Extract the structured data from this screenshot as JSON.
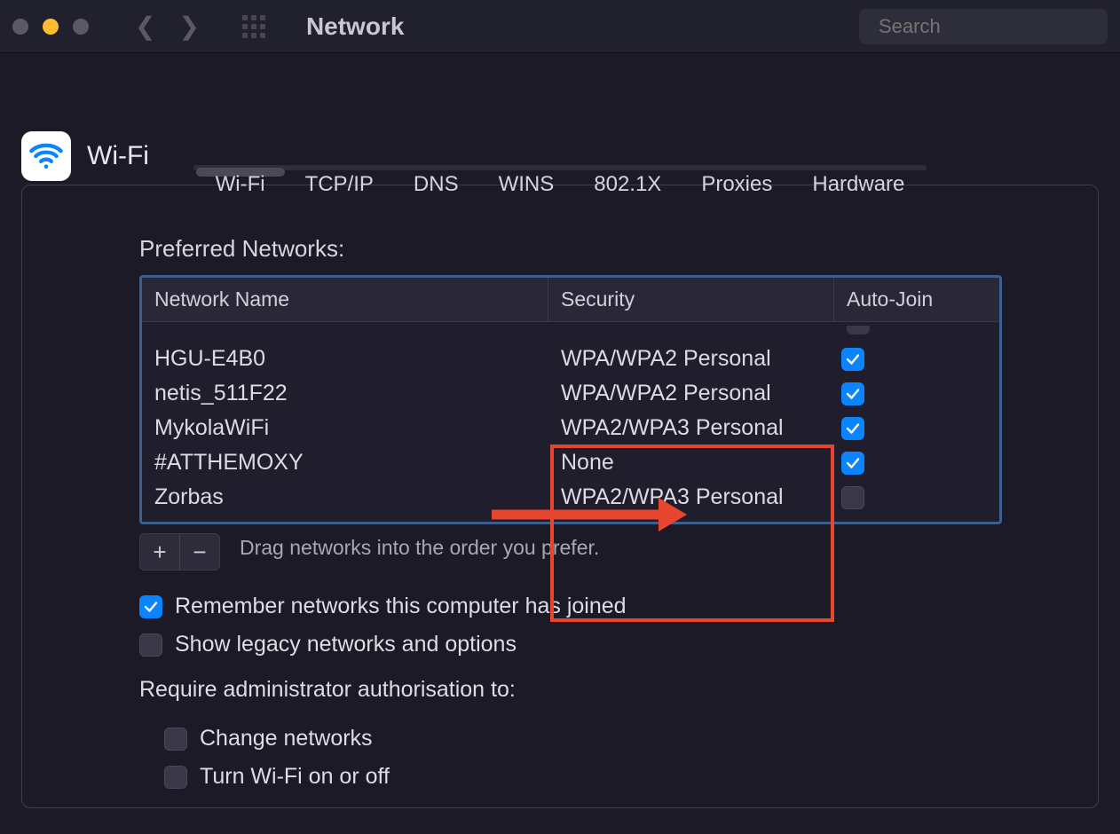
{
  "window": {
    "title": "Network",
    "search_placeholder": "Search"
  },
  "pref": {
    "title": "Wi-Fi"
  },
  "tabs": [
    {
      "label": "Wi-Fi",
      "active": true
    },
    {
      "label": "TCP/IP",
      "active": false
    },
    {
      "label": "DNS",
      "active": false
    },
    {
      "label": "WINS",
      "active": false
    },
    {
      "label": "802.1X",
      "active": false
    },
    {
      "label": "Proxies",
      "active": false
    },
    {
      "label": "Hardware",
      "active": false
    }
  ],
  "section": {
    "label": "Preferred Networks:",
    "columns": {
      "name": "Network Name",
      "security": "Security",
      "auto": "Auto-Join"
    },
    "rows": [
      {
        "name": "HGU-E4B0",
        "security": "WPA/WPA2 Personal",
        "auto": true
      },
      {
        "name": "netis_511F22",
        "security": "WPA/WPA2 Personal",
        "auto": true
      },
      {
        "name": "MykolaWiFi",
        "security": "WPA2/WPA3 Personal",
        "auto": true
      },
      {
        "name": "#ATTHEMOXY",
        "security": "None",
        "auto": true
      },
      {
        "name": "Zorbas",
        "security": "WPA2/WPA3 Personal",
        "auto": false
      }
    ],
    "hint": "Drag networks into the order you prefer.",
    "add": "+",
    "remove": "−"
  },
  "options": {
    "remember": {
      "label": "Remember networks this computer has joined",
      "checked": true
    },
    "legacy": {
      "label": "Show legacy networks and options",
      "checked": false
    },
    "admin_label": "Require administrator authorisation to:",
    "change": {
      "label": "Change networks",
      "checked": false
    },
    "turn": {
      "label": "Turn Wi-Fi on or off",
      "checked": false
    }
  }
}
